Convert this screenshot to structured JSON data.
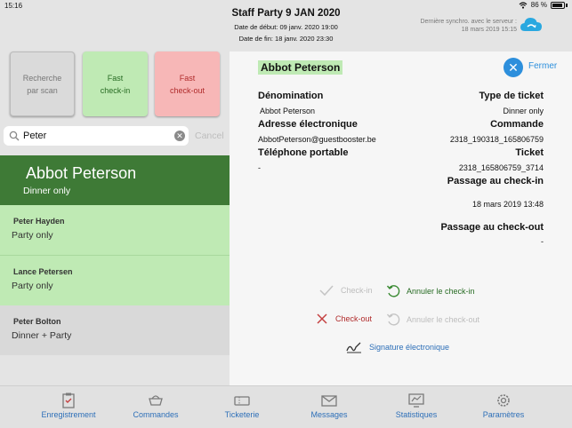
{
  "status": {
    "time": "15:16",
    "battery": "86 %"
  },
  "header": {
    "title": "Staff Party 9 JAN 2020",
    "start": "Date de début: 09 janv. 2020 19:00",
    "end": "Date de fin: 18 janv. 2020 23:30",
    "sync_line1": "Dernière synchro. avec le serveur :",
    "sync_line2": "18 mars 2019 15:15"
  },
  "actions": {
    "scan": "Recherche\npar scan",
    "fast_in": "Fast\ncheck-in",
    "fast_out": "Fast\ncheck-out"
  },
  "search": {
    "value": "Peter",
    "cancel": "Cancel"
  },
  "list": [
    {
      "name": "Abbot Peterson",
      "sub": "Dinner only"
    },
    {
      "name": "Peter Hayden",
      "sub": "Party only"
    },
    {
      "name": "Lance Petersen",
      "sub": "Party only"
    },
    {
      "name": "Peter Bolton",
      "sub": "Dinner + Party"
    }
  ],
  "detail": {
    "name": "Abbot Peterson",
    "close": "Fermer",
    "denomination_label": "Dénomination",
    "denomination_value": "Abbot Peterson",
    "ticket_type_label": "Type de ticket",
    "ticket_type_value": "Dinner only",
    "email_label": "Adresse électronique",
    "email_value": "AbbotPeterson@guestbooster.be",
    "order_label": "Commande",
    "order_value": "2318_190318_165806759",
    "phone_label": "Téléphone portable",
    "phone_value": "-",
    "ticket_label": "Ticket",
    "ticket_value": "2318_165806759_3714",
    "checkin_pass_label": "Passage au check-in",
    "checkin_pass_value": "18 mars 2019 13:48",
    "checkout_pass_label": "Passage au check-out",
    "checkout_pass_value": "-",
    "checkin": "Check-in",
    "undo_checkin": "Annuler le check-in",
    "checkout": "Check-out",
    "undo_checkout": "Annuler le check-out",
    "signature": "Signature électronique"
  },
  "tabs": [
    {
      "label": "Enregistrement"
    },
    {
      "label": "Commandes"
    },
    {
      "label": "Ticketerie"
    },
    {
      "label": "Messages"
    },
    {
      "label": "Statistiques"
    },
    {
      "label": "Paramètres"
    }
  ]
}
